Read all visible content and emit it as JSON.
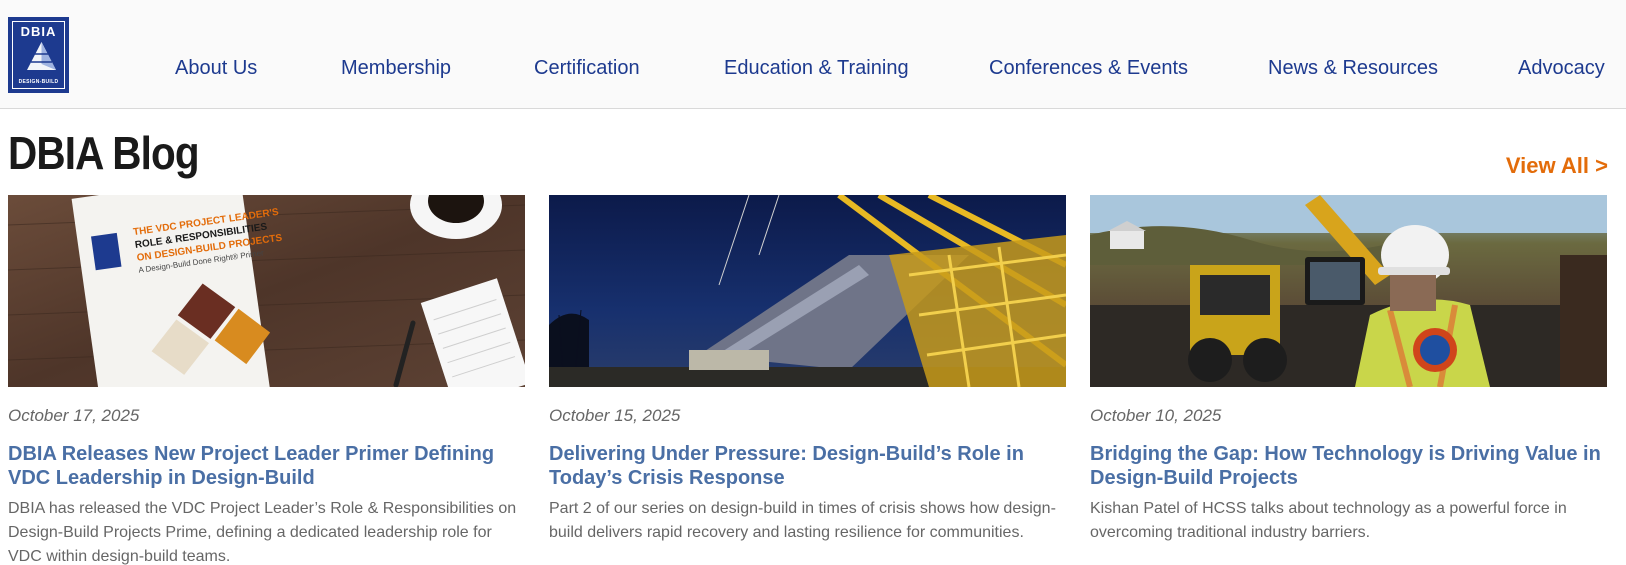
{
  "logo": {
    "top_text": "DBIA",
    "bottom_text": "DESIGN-BUILD"
  },
  "nav": [
    {
      "label": "About Us"
    },
    {
      "label": "Membership"
    },
    {
      "label": "Certification"
    },
    {
      "label": "Education & Training"
    },
    {
      "label": "Conferences & Events"
    },
    {
      "label": "News & Resources"
    },
    {
      "label": "Advocacy"
    }
  ],
  "blog": {
    "title": "DBIA Blog",
    "view_all": "View All >"
  },
  "cards": [
    {
      "date": "October 17, 2025",
      "title": "DBIA Releases New Project Leader Primer Defining VDC Leadership in Design-Build",
      "excerpt": "DBIA has released the VDC Project Leader’s Role & Responsibilities on Design-Build Projects Prime, defining a dedicated leadership role for VDC within design-build teams.",
      "image_text": {
        "line1": "THE VDC PROJECT LEADER'S",
        "line2": "ROLE & RESPONSIBILITIES",
        "line3": "ON DESIGN-BUILD PROJECTS",
        "line4": "A Design-Build Done Right® Primer"
      }
    },
    {
      "date": "October 15, 2025",
      "title": "Delivering Under Pressure: Design-Build’s Role in Today’s Crisis Response",
      "excerpt": "Part 2 of our series on design-build in times of crisis shows how design-build delivers rapid recovery and lasting resilience for communities."
    },
    {
      "date": "October 10, 2025",
      "title": "Bridging the Gap: How Technology is Driving Value in Design-Build Projects",
      "excerpt": "Kishan Patel of HCSS talks about technology as a powerful force in overcoming traditional industry barriers."
    }
  ],
  "colors": {
    "brand_blue": "#1d3a8f",
    "link_blue": "#4a6fa5",
    "accent_orange": "#e36c0a"
  }
}
